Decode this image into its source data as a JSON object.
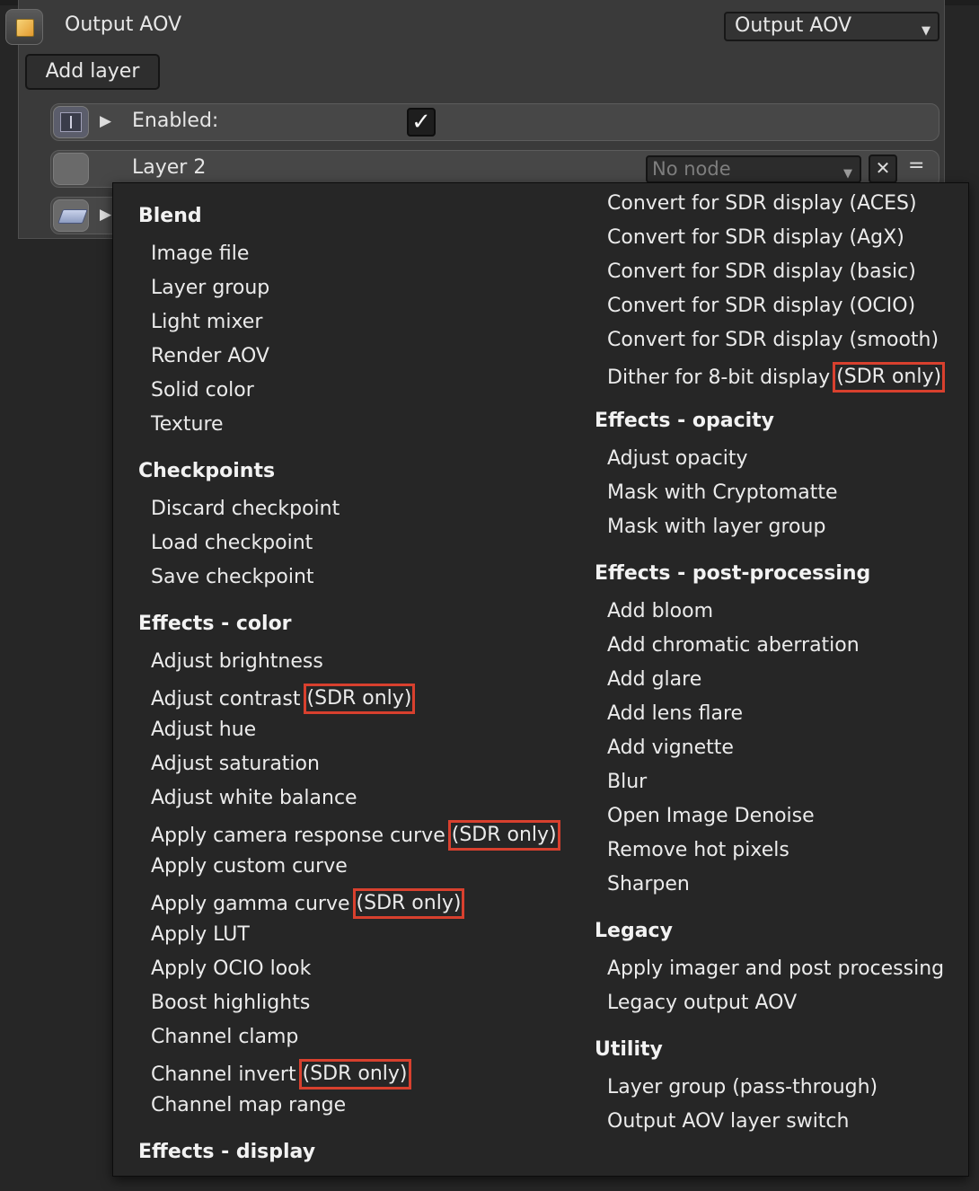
{
  "header": {
    "title": "Output AOV",
    "dropdown_value": "Output AOV"
  },
  "toolbar": {
    "add_layer_label": "Add layer"
  },
  "rows": {
    "enabled_label": "Enabled:",
    "enabled_checked": true,
    "enabled_check_glyph": "✓",
    "layer2_label": "Layer 2",
    "layer2_node_placeholder": "No node",
    "close_glyph": "✕",
    "menu_glyph": "="
  },
  "menu": {
    "sdr_tag": "(SDR only)",
    "headings": {
      "blend": "Blend",
      "checkpoints": "Checkpoints",
      "effects_color": "Effects - color",
      "effects_display": "Effects - display",
      "effects_opacity": "Effects - opacity",
      "effects_post": "Effects - post-processing",
      "legacy": "Legacy",
      "utility": "Utility"
    },
    "blend": [
      "Image file",
      "Layer group",
      "Light mixer",
      "Render AOV",
      "Solid color",
      "Texture"
    ],
    "checkpoints": [
      "Discard checkpoint",
      "Load checkpoint",
      "Save checkpoint"
    ],
    "effects_color": [
      "Adjust brightness",
      "Adjust contrast",
      "Adjust hue",
      "Adjust saturation",
      "Adjust white balance",
      "Apply camera response curve",
      "Apply custom curve",
      "Apply gamma curve",
      "Apply LUT",
      "Apply OCIO look",
      "Boost highlights",
      "Channel clamp",
      "Channel invert",
      "Channel map range"
    ],
    "effects_display": [
      "Convert for SDR display (ACES)",
      "Convert for SDR display (AgX)",
      "Convert for SDR display (basic)",
      "Convert for SDR display (OCIO)",
      "Convert for SDR display (smooth)",
      "Dither for 8-bit display"
    ],
    "effects_opacity": [
      "Adjust opacity",
      "Mask with Cryptomatte",
      "Mask with layer group"
    ],
    "effects_post": [
      "Add bloom",
      "Add chromatic aberration",
      "Add glare",
      "Add lens flare",
      "Add vignette",
      "Blur",
      "Open Image Denoise",
      "Remove hot pixels",
      "Sharpen"
    ],
    "legacy": [
      "Apply imager and post processing",
      "Legacy output AOV"
    ],
    "utility": [
      "Layer group (pass-through)",
      "Output AOV layer switch"
    ]
  },
  "colors": {
    "highlight_box": "#d8402e",
    "menu_bg": "#262626",
    "panel_bg": "#3a3a3a"
  }
}
